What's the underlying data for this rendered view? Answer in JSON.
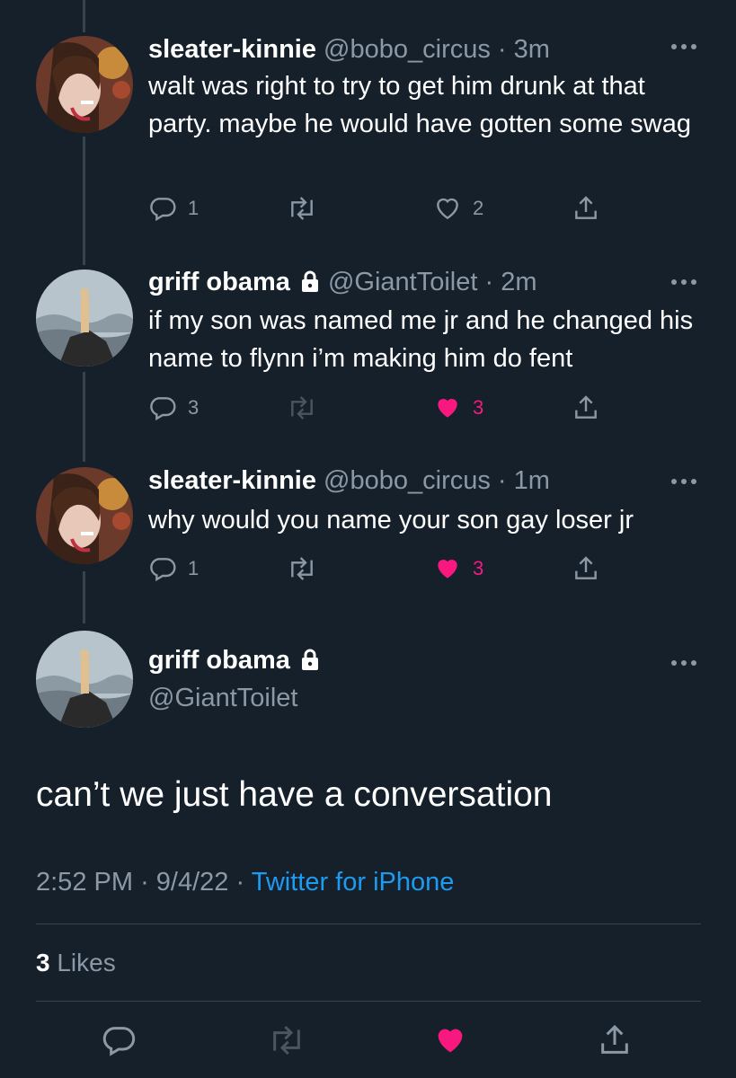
{
  "tweets": [
    {
      "name": "sleater-kinnie",
      "handle": "@bobo_circus",
      "sep": "·",
      "time": "3m",
      "text": "walt was right to try to get him drunk at that party. maybe he would have gotten some swag",
      "replies": "1",
      "retweets": "",
      "likes": "2",
      "liked": false,
      "locked": false
    },
    {
      "name": "griff obama",
      "handle": "@GiantToilet",
      "sep": "·",
      "time": "2m",
      "text": "if my son was named me jr and he changed his name to flynn i’m making him do fent",
      "replies": "3",
      "retweets": "",
      "likes": "3",
      "liked": true,
      "locked": true
    },
    {
      "name": "sleater-kinnie",
      "handle": "@bobo_circus",
      "sep": "·",
      "time": "1m",
      "text": "why would you name your son gay loser jr",
      "replies": "1",
      "retweets": "",
      "likes": "3",
      "liked": true,
      "locked": false
    }
  ],
  "main_tweet": {
    "name": "griff obama",
    "handle": "@GiantToilet",
    "text": "can’t we just have a conversation",
    "time": "2:52 PM",
    "sep1": "·",
    "date": "9/4/22",
    "sep2": "·",
    "source": "Twitter for iPhone",
    "likes_count": "3",
    "likes_label": "Likes",
    "liked": true
  },
  "icons": {
    "reply": "reply-icon",
    "retweet": "retweet-icon",
    "like": "heart-icon",
    "share": "share-icon",
    "more": "more-icon",
    "lock": "lock-icon"
  },
  "colors": {
    "background": "#15202b",
    "text": "#ffffff",
    "secondary": "#8b98a5",
    "accent": "#1d9bf0",
    "like": "#f91880",
    "divider": "#38444d"
  }
}
